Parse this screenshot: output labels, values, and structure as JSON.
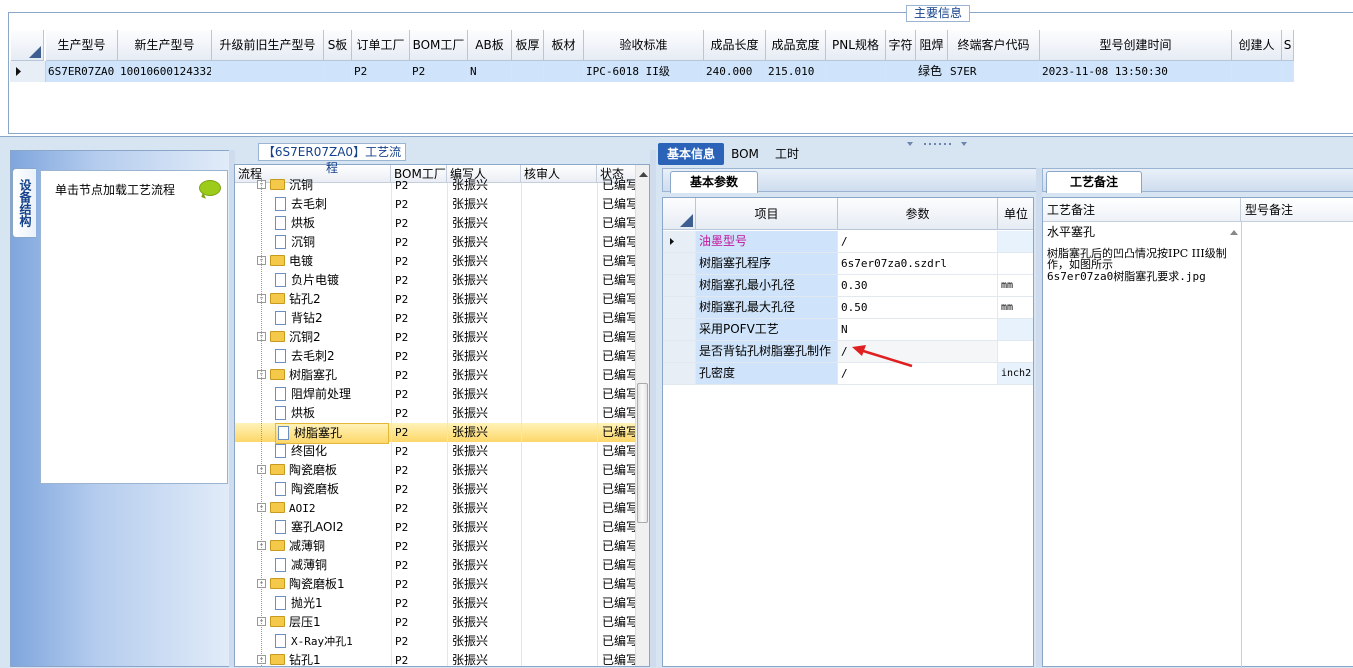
{
  "main_info": {
    "caption": "主要信息",
    "columns": [
      "生产型号",
      "新生产型号",
      "升级前旧生产型号",
      "S板",
      "订单工厂",
      "BOM工厂",
      "AB板",
      "板厚",
      "板材",
      "验收标准",
      "成品长度",
      "成品宽度",
      "PNL规格",
      "字符",
      "阻焊",
      "终端客户代码",
      "型号创建时间",
      "创建人",
      "S"
    ],
    "row": [
      "6S7ER07ZA0",
      "10010600124332",
      "",
      "",
      "P2",
      "P2",
      "N",
      "",
      "",
      "IPC-6018 II级",
      "240.000",
      "215.010",
      "",
      "",
      "绿色",
      "S7ER",
      "2023-11-08 13:50:30",
      "",
      ""
    ]
  },
  "left_panel": {
    "vertical_tab": "设备结构",
    "hint": "单击节点加载工艺流程"
  },
  "flow": {
    "caption": "【6S7ER07ZA0】工艺流程",
    "columns": [
      "流程",
      "BOM工厂",
      "编写人",
      "核审人",
      "状态"
    ],
    "rows": [
      {
        "name": "沉铜",
        "level": 0,
        "kind": "folder",
        "factory": "P2",
        "writer": "张振兴",
        "reviewer": "",
        "status": "已编写"
      },
      {
        "name": "去毛刺",
        "level": 1,
        "kind": "doc",
        "factory": "P2",
        "writer": "张振兴",
        "reviewer": "",
        "status": "已编写"
      },
      {
        "name": "烘板",
        "level": 1,
        "kind": "doc",
        "factory": "P2",
        "writer": "张振兴",
        "reviewer": "",
        "status": "已编写"
      },
      {
        "name": "沉铜",
        "level": 1,
        "kind": "doc",
        "factory": "P2",
        "writer": "张振兴",
        "reviewer": "",
        "status": "已编写"
      },
      {
        "name": "电镀",
        "level": 0,
        "kind": "folder",
        "factory": "P2",
        "writer": "张振兴",
        "reviewer": "",
        "status": "已编写"
      },
      {
        "name": "负片电镀",
        "level": 1,
        "kind": "doc",
        "factory": "P2",
        "writer": "张振兴",
        "reviewer": "",
        "status": "已编写"
      },
      {
        "name": "钻孔2",
        "level": 0,
        "kind": "folder",
        "factory": "P2",
        "writer": "张振兴",
        "reviewer": "",
        "status": "已编写"
      },
      {
        "name": "背钻2",
        "level": 1,
        "kind": "doc",
        "factory": "P2",
        "writer": "张振兴",
        "reviewer": "",
        "status": "已编写"
      },
      {
        "name": "沉铜2",
        "level": 0,
        "kind": "folder",
        "factory": "P2",
        "writer": "张振兴",
        "reviewer": "",
        "status": "已编写"
      },
      {
        "name": "去毛刺2",
        "level": 1,
        "kind": "doc",
        "factory": "P2",
        "writer": "张振兴",
        "reviewer": "",
        "status": "已编写"
      },
      {
        "name": "树脂塞孔",
        "level": 0,
        "kind": "folder",
        "factory": "P2",
        "writer": "张振兴",
        "reviewer": "",
        "status": "已编写"
      },
      {
        "name": "阻焊前处理",
        "level": 1,
        "kind": "doc",
        "factory": "P2",
        "writer": "张振兴",
        "reviewer": "",
        "status": "已编写"
      },
      {
        "name": "烘板",
        "level": 1,
        "kind": "doc",
        "factory": "P2",
        "writer": "张振兴",
        "reviewer": "",
        "status": "已编写"
      },
      {
        "name": "树脂塞孔",
        "level": 1,
        "kind": "doc",
        "factory": "P2",
        "writer": "张振兴",
        "reviewer": "",
        "status": "已编写",
        "selected": true
      },
      {
        "name": "终固化",
        "level": 1,
        "kind": "doc",
        "factory": "P2",
        "writer": "张振兴",
        "reviewer": "",
        "status": "已编写"
      },
      {
        "name": "陶瓷磨板",
        "level": 0,
        "kind": "folder",
        "factory": "P2",
        "writer": "张振兴",
        "reviewer": "",
        "status": "已编写"
      },
      {
        "name": "陶瓷磨板",
        "level": 1,
        "kind": "doc",
        "factory": "P2",
        "writer": "张振兴",
        "reviewer": "",
        "status": "已编写"
      },
      {
        "name": "AOI2",
        "level": 0,
        "kind": "folder",
        "factory": "P2",
        "writer": "张振兴",
        "reviewer": "",
        "status": "已编写"
      },
      {
        "name": "塞孔AOI2",
        "level": 1,
        "kind": "doc",
        "factory": "P2",
        "writer": "张振兴",
        "reviewer": "",
        "status": "已编写"
      },
      {
        "name": "减薄铜",
        "level": 0,
        "kind": "folder",
        "factory": "P2",
        "writer": "张振兴",
        "reviewer": "",
        "status": "已编写"
      },
      {
        "name": "减薄铜",
        "level": 1,
        "kind": "doc",
        "factory": "P2",
        "writer": "张振兴",
        "reviewer": "",
        "status": "已编写"
      },
      {
        "name": "陶瓷磨板1",
        "level": 0,
        "kind": "folder",
        "factory": "P2",
        "writer": "张振兴",
        "reviewer": "",
        "status": "已编写"
      },
      {
        "name": "抛光1",
        "level": 1,
        "kind": "doc",
        "factory": "P2",
        "writer": "张振兴",
        "reviewer": "",
        "status": "已编写"
      },
      {
        "name": "层压1",
        "level": 0,
        "kind": "folder",
        "factory": "P2",
        "writer": "张振兴",
        "reviewer": "",
        "status": "已编写"
      },
      {
        "name": "X-Ray冲孔1",
        "level": 1,
        "kind": "doc",
        "factory": "P2",
        "writer": "张振兴",
        "reviewer": "",
        "status": "已编写"
      },
      {
        "name": "钻孔1",
        "level": 0,
        "kind": "folder",
        "factory": "P2",
        "writer": "张振兴",
        "reviewer": "",
        "status": "已编写"
      }
    ]
  },
  "info_tabs": [
    "基本信息",
    "BOM",
    "工时"
  ],
  "params": {
    "tab": "基本参数",
    "columns": [
      "项目",
      "参数",
      "单位"
    ],
    "rows": [
      {
        "item": "油墨型号",
        "value": "/",
        "unit": ""
      },
      {
        "item": "树脂塞孔程序",
        "value": "6s7er07za0.szdrl",
        "unit": ""
      },
      {
        "item": "树脂塞孔最小孔径",
        "value": "0.30",
        "unit": "mm"
      },
      {
        "item": "树脂塞孔最大孔径",
        "value": "0.50",
        "unit": "mm"
      },
      {
        "item": "采用POFV工艺",
        "value": "N",
        "unit": ""
      },
      {
        "item": "是否背钻孔树脂塞孔制作",
        "value": "/",
        "unit": ""
      },
      {
        "item": "孔密度",
        "value": "/",
        "unit": "inch2"
      }
    ]
  },
  "notes": {
    "tab": "工艺备注",
    "columns": [
      "工艺备注",
      "型号备注"
    ],
    "title": "水平塞孔",
    "body": "树脂塞孔后的凹凸情况按IPC III级制作，如图所示",
    "file": "6s7er07za0树脂塞孔要求.jpg"
  },
  "colors": {
    "accent": "#15428b",
    "selected_row": "#cfe4fa",
    "tab_active": "#2a63b8",
    "annotation_arrow": "#e02020",
    "ink_highlight": "#c0169e"
  }
}
